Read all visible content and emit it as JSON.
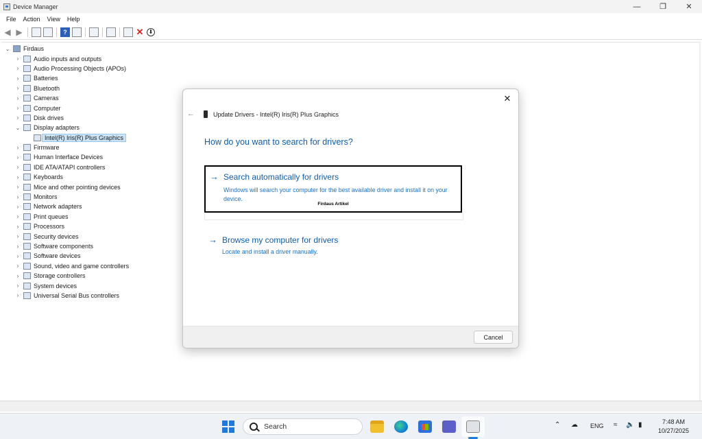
{
  "window": {
    "title": "Device Manager",
    "controls": {
      "minimize": "—",
      "restore": "❐",
      "close": "✕"
    }
  },
  "menubar": [
    "File",
    "Action",
    "View",
    "Help"
  ],
  "tree": {
    "root": "Firdaus",
    "items": [
      "Audio inputs and outputs",
      "Audio Processing Objects (APOs)",
      "Batteries",
      "Bluetooth",
      "Cameras",
      "Computer",
      "Disk drives",
      "Display adapters",
      "Intel(R) Iris(R) Plus Graphics",
      "Firmware",
      "Human Interface Devices",
      "IDE ATA/ATAPI controllers",
      "Keyboards",
      "Mice and other pointing devices",
      "Monitors",
      "Network adapters",
      "Print queues",
      "Processors",
      "Security devices",
      "Software components",
      "Software devices",
      "Sound, video and game controllers",
      "Storage controllers",
      "System devices",
      "Universal Serial Bus controllers"
    ]
  },
  "dialog": {
    "title": "Update Drivers - Intel(R) Iris(R) Plus Graphics",
    "heading": "How do you want to search for drivers?",
    "option1": {
      "title": "Search automatically for drivers",
      "desc": "Windows will search your computer for the best available driver and install it on your device."
    },
    "watermark": "Firdaus Artikel",
    "option2": {
      "title": "Browse my computer for drivers",
      "desc": "Locate and install a driver manually."
    },
    "cancel": "Cancel"
  },
  "taskbar": {
    "search_placeholder": "Search",
    "lang": "ENG",
    "time": "7:48 AM",
    "date": "10/27/2025"
  }
}
